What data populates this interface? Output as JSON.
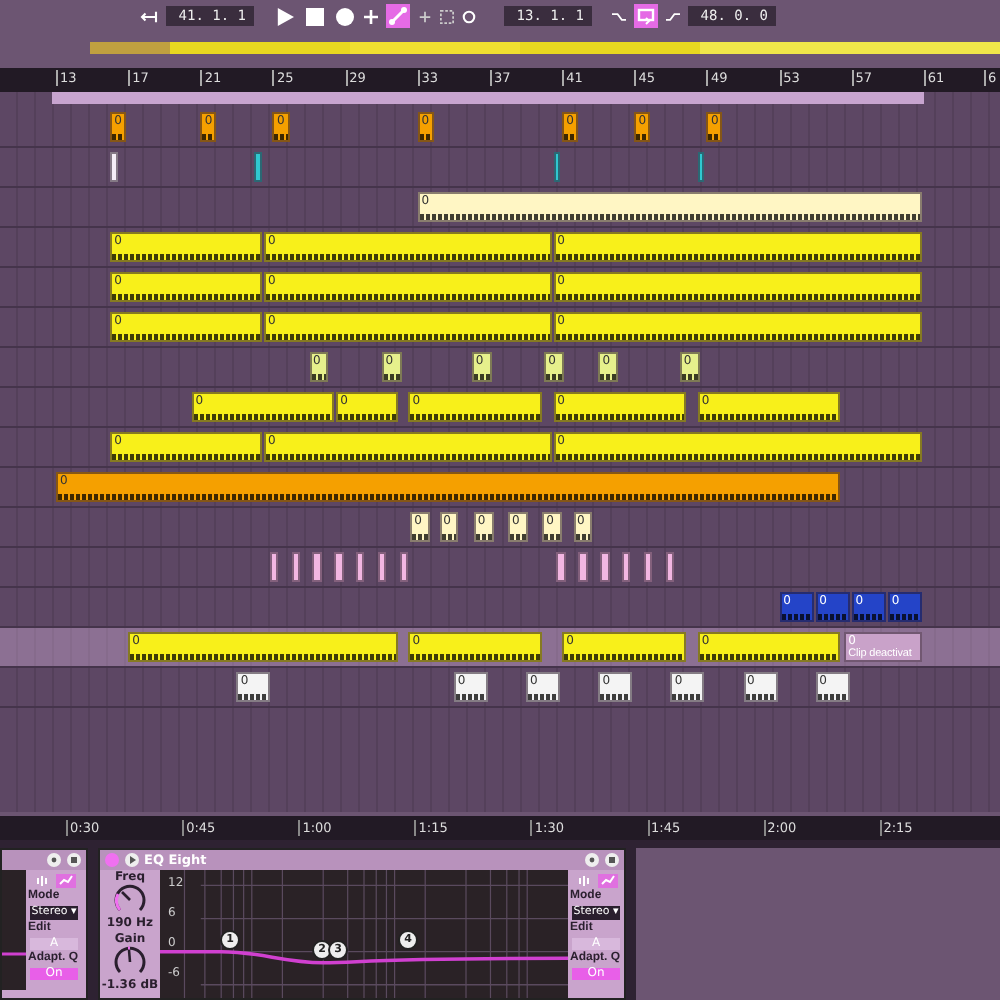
{
  "transport": {
    "position": "41. 1. 1",
    "loop_start": "13. 1. 1",
    "loop_length": "48. 0. 0",
    "automation_arm": true,
    "loop_on": true
  },
  "ruler": [
    "13",
    "17",
    "21",
    "25",
    "29",
    "33",
    "37",
    "41",
    "45",
    "49",
    "53",
    "57",
    "61",
    "6"
  ],
  "tracks": [
    {
      "selected": false,
      "clips": [
        {
          "kind": "midi",
          "color": "#f5a000",
          "label": "0"
        },
        {
          "kind": "midi",
          "color": "#f5a000",
          "label": "0"
        },
        {
          "kind": "midi",
          "color": "#f5a000",
          "label": "0"
        },
        {
          "kind": "midi",
          "color": "#f5a000",
          "label": "0"
        },
        {
          "kind": "midi",
          "color": "#f5a000",
          "label": "0"
        },
        {
          "kind": "midi",
          "color": "#f5a000",
          "label": "0"
        },
        {
          "kind": "midi",
          "color": "#f5a000",
          "label": "0"
        }
      ]
    },
    {
      "selected": false,
      "clips": [
        {
          "kind": "audio",
          "color": "#f4eef6"
        },
        {
          "kind": "audio",
          "color": "#30c8d0"
        },
        {
          "kind": "audio",
          "color": "#30c8d0"
        },
        {
          "kind": "audio",
          "color": "#30c8d0"
        }
      ]
    },
    {
      "selected": false,
      "clips": [
        {
          "kind": "midi",
          "color": "#fff6c4",
          "label": "0"
        }
      ]
    },
    {
      "selected": false,
      "clips": [
        {
          "kind": "midi",
          "color": "#f8f01a",
          "label": "0"
        },
        {
          "kind": "midi",
          "color": "#f8f01a",
          "label": "0"
        },
        {
          "kind": "midi",
          "color": "#f8f01a",
          "label": "0"
        }
      ]
    },
    {
      "selected": false,
      "clips": [
        {
          "kind": "midi",
          "color": "#f8f01a",
          "label": "0"
        },
        {
          "kind": "midi",
          "color": "#f8f01a",
          "label": "0"
        },
        {
          "kind": "midi",
          "color": "#f8f01a",
          "label": "0"
        }
      ]
    },
    {
      "selected": false,
      "clips": [
        {
          "kind": "midi",
          "color": "#f8f01a",
          "label": "0"
        },
        {
          "kind": "midi",
          "color": "#f8f01a",
          "label": "0"
        },
        {
          "kind": "midi",
          "color": "#f8f01a",
          "label": "0"
        }
      ]
    },
    {
      "selected": false,
      "clips": [
        {
          "kind": "midi",
          "color": "#e6f08c",
          "label": "0"
        },
        {
          "kind": "midi",
          "color": "#e6f08c",
          "label": "0"
        },
        {
          "kind": "midi",
          "color": "#e6f08c",
          "label": "0"
        },
        {
          "kind": "midi",
          "color": "#e6f08c",
          "label": "0"
        },
        {
          "kind": "midi",
          "color": "#e6f08c",
          "label": "0"
        },
        {
          "kind": "midi",
          "color": "#e6f08c",
          "label": "0"
        }
      ]
    },
    {
      "selected": false,
      "clips": [
        {
          "kind": "midi",
          "color": "#f8f01a",
          "label": "0"
        },
        {
          "kind": "midi",
          "color": "#f8f01a",
          "label": "0"
        },
        {
          "kind": "midi",
          "color": "#f8f01a",
          "label": "0"
        },
        {
          "kind": "midi",
          "color": "#f8f01a",
          "label": "0"
        },
        {
          "kind": "midi",
          "color": "#f8f01a",
          "label": "0"
        }
      ]
    },
    {
      "selected": false,
      "clips": [
        {
          "kind": "midi",
          "color": "#f8f01a",
          "label": "0"
        },
        {
          "kind": "midi",
          "color": "#f8f01a",
          "label": "0"
        },
        {
          "kind": "midi",
          "color": "#f8f01a",
          "label": "0"
        }
      ]
    },
    {
      "selected": false,
      "clips": [
        {
          "kind": "midi",
          "color": "#f5a000",
          "label": "0"
        }
      ]
    },
    {
      "selected": false,
      "clips": [
        {
          "kind": "midi",
          "color": "#fff6c4",
          "label": "0"
        },
        {
          "kind": "midi",
          "color": "#fff6c4",
          "label": "0"
        },
        {
          "kind": "midi",
          "color": "#fff6c4",
          "label": "0"
        },
        {
          "kind": "midi",
          "color": "#fff6c4",
          "label": "0"
        },
        {
          "kind": "midi",
          "color": "#fff6c4",
          "label": "0"
        },
        {
          "kind": "midi",
          "color": "#fff6c4",
          "label": "0"
        }
      ]
    },
    {
      "selected": false,
      "clips": [
        {
          "kind": "audio",
          "color": "#f2b6e2"
        },
        {
          "kind": "audio",
          "color": "#f2b6e2"
        },
        {
          "kind": "audio",
          "color": "#f2b6e2"
        },
        {
          "kind": "audio",
          "color": "#f2b6e2"
        },
        {
          "kind": "audio",
          "color": "#f2b6e2"
        },
        {
          "kind": "audio",
          "color": "#f2b6e2"
        },
        {
          "kind": "audio",
          "color": "#f2b6e2"
        },
        {
          "kind": "audio",
          "color": "#f2b6e2"
        },
        {
          "kind": "audio",
          "color": "#f2b6e2"
        },
        {
          "kind": "audio",
          "color": "#f2b6e2"
        },
        {
          "kind": "audio",
          "color": "#f2b6e2"
        },
        {
          "kind": "audio",
          "color": "#f2b6e2"
        },
        {
          "kind": "audio",
          "color": "#f2b6e2"
        }
      ]
    },
    {
      "selected": false,
      "clips": [
        {
          "kind": "midi",
          "color": "#2444c8",
          "label": "0"
        },
        {
          "kind": "midi",
          "color": "#2444c8",
          "label": "0"
        },
        {
          "kind": "midi",
          "color": "#2444c8",
          "label": "0"
        },
        {
          "kind": "midi",
          "color": "#2444c8",
          "label": "0"
        }
      ]
    },
    {
      "selected": true,
      "clips": [
        {
          "kind": "midi",
          "color": "#f8f01a",
          "label": "0"
        },
        {
          "kind": "midi",
          "color": "#f8f01a",
          "label": "0"
        },
        {
          "kind": "midi",
          "color": "#f8f01a",
          "label": "0"
        },
        {
          "kind": "midi",
          "color": "#f8f01a",
          "label": "0"
        },
        {
          "kind": "deactivated",
          "color": "#c9a2c9",
          "label": "0",
          "note": "Clip deactivat"
        }
      ]
    },
    {
      "selected": false,
      "clips": [
        {
          "kind": "midi",
          "color": "#f4f4f4",
          "label": "0"
        },
        {
          "kind": "midi",
          "color": "#f4f4f4",
          "label": "0"
        },
        {
          "kind": "midi",
          "color": "#f4f4f4",
          "label": "0"
        },
        {
          "kind": "midi",
          "color": "#f4f4f4",
          "label": "0"
        },
        {
          "kind": "midi",
          "color": "#f4f4f4",
          "label": "0"
        },
        {
          "kind": "midi",
          "color": "#f4f4f4",
          "label": "0"
        },
        {
          "kind": "midi",
          "color": "#f4f4f4",
          "label": "0"
        }
      ]
    }
  ],
  "time_ruler": [
    "0:30",
    "0:45",
    "1:00",
    "1:15",
    "1:30",
    "1:45",
    "2:00",
    "2:15"
  ],
  "devices": [
    {
      "kind": "partial",
      "side": {
        "mode_label": "Mode",
        "mode": "Stereo ▾",
        "edit_label": "Edit",
        "edit": "A",
        "adapt_label": "Adapt. Q",
        "adapt": "On",
        "adapt_on": true
      }
    },
    {
      "kind": "eq",
      "title": "EQ Eight",
      "on": true,
      "freq_label": "Freq",
      "freq": "190 Hz",
      "gain_label": "Gain",
      "gain": "-1.36 dB",
      "y_labels": [
        "12",
        "6",
        "0",
        "-6"
      ],
      "bands": [
        "1",
        "2",
        "3",
        "4"
      ],
      "side": {
        "mode_label": "Mode",
        "mode": "Stereo ▾",
        "edit_label": "Edit",
        "edit": "A",
        "adapt_label": "Adapt. Q",
        "adapt": "On",
        "adapt_on": true
      }
    }
  ]
}
